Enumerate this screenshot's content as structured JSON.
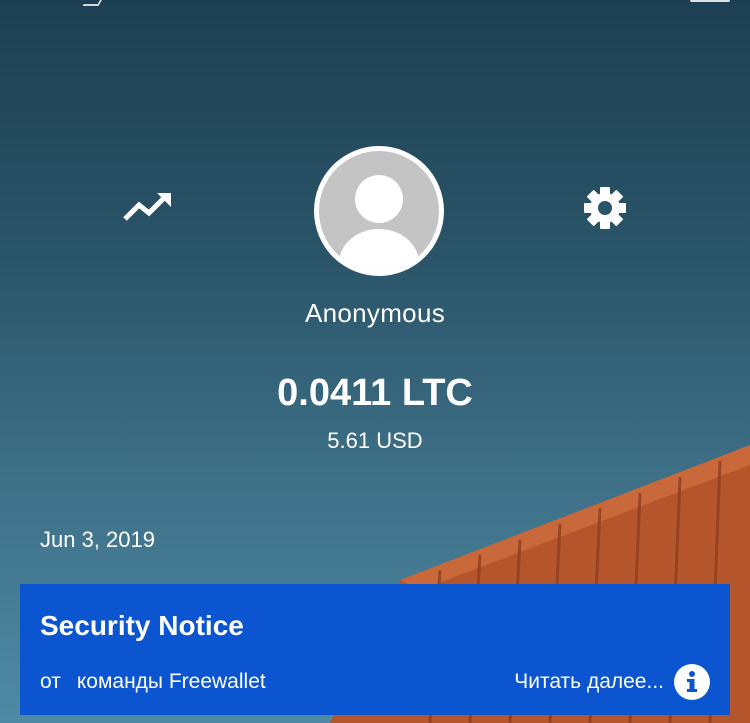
{
  "profile": {
    "name": "Anonymous",
    "avatar_icon": "default-avatar-icon"
  },
  "wallet": {
    "balance": "0.0411 LTC",
    "fiat_value": "5.61 USD"
  },
  "header": {
    "left_icon": "trending-up-icon",
    "right_icon": "gear-icon"
  },
  "feed": {
    "date": "Jun 3, 2019"
  },
  "notice": {
    "title": "Security Notice",
    "from_word": "от",
    "from_team": "команды Freewallet",
    "read_more": "Читать далее...",
    "icon": "info-icon",
    "color": "#0b55d0"
  },
  "colors": {
    "background_top": "#1e3f53",
    "background_bottom": "#4e8aa5",
    "container": "#b5542a"
  }
}
